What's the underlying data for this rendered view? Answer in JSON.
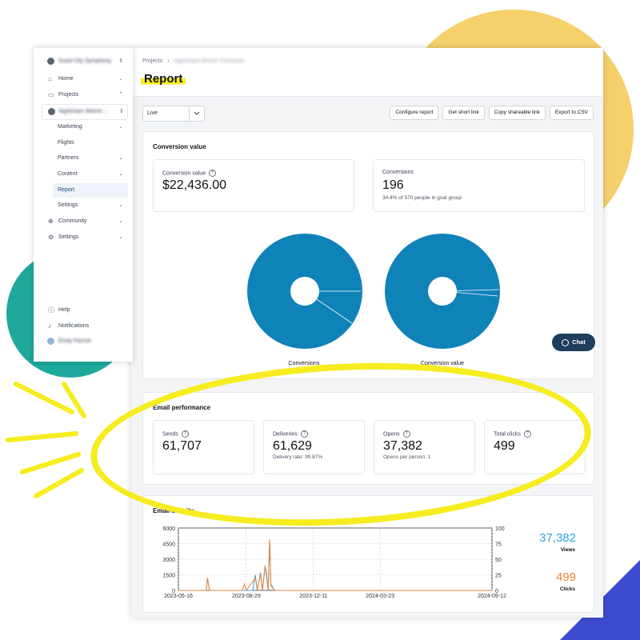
{
  "sidebar": {
    "org_name": "Good City Symphony",
    "items": [
      {
        "label": "Home",
        "icon": "home-icon"
      },
      {
        "label": "Projects",
        "icon": "folder-icon"
      },
      {
        "label": "Nightmare Before ...",
        "icon": "avatar"
      },
      {
        "label": "Marketing"
      },
      {
        "label": "Flights"
      },
      {
        "label": "Partners"
      },
      {
        "label": "Content"
      },
      {
        "label": "Report"
      },
      {
        "label": "Settings"
      },
      {
        "label": "Community",
        "icon": "community-icon"
      },
      {
        "label": "Settings",
        "icon": "gear-icon"
      }
    ],
    "footer": [
      {
        "label": "Help",
        "icon": "help-icon"
      },
      {
        "label": "Notifications",
        "icon": "bell-icon"
      },
      {
        "label": "Emily Parrish",
        "icon": "avatar"
      }
    ]
  },
  "header": {
    "breadcrumb_root": "Projects",
    "breadcrumb_sep": "›",
    "breadcrumb_current": "Nightmare Before Christmas",
    "title": "Report"
  },
  "toolbar": {
    "select_value": "Live",
    "buttons": [
      "Configure report",
      "Get short link",
      "Copy shareable link",
      "Export to CSV"
    ]
  },
  "conversion": {
    "title": "Conversion value",
    "value_label": "Conversion value",
    "value": "$22,436.00",
    "count_label": "Conversions",
    "count": "196",
    "count_sub": "34.4% of 570 people in goal group",
    "pie1_label": "Conversions",
    "pie2_label": "Conversion value"
  },
  "chat_label": "Chat",
  "email_performance": {
    "title": "Email performance",
    "stats": [
      {
        "label": "Sends",
        "value": "61,707",
        "sub": ""
      },
      {
        "label": "Deliveries",
        "value": "61,629",
        "sub": "Delivery rate: 99.87%"
      },
      {
        "label": "Opens",
        "value": "37,382",
        "sub": "Opens per person: 1"
      },
      {
        "label": "Total clicks",
        "value": "499",
        "sub": ""
      }
    ]
  },
  "email_activity": {
    "title": "Email activity",
    "views_value": "37,382",
    "views_label": "Views",
    "clicks_value": "499",
    "clicks_label": "Clicks"
  },
  "colors": {
    "pie": "#0f82b8",
    "views": "#30a6e0",
    "clicks": "#e8843a",
    "highlight": "#f6ec1f"
  },
  "chart_data": {
    "type": "line",
    "x_ticks": [
      "2023-05-16",
      "2023-08-29",
      "2023-12-11",
      "2024-03-23",
      "2024-09-12"
    ],
    "y_left_ticks": [
      "6000",
      "4500",
      "3000",
      "1500",
      "0"
    ],
    "y_right_ticks": [
      "100",
      "75",
      "50",
      "25",
      "0"
    ],
    "ylim_left": [
      0,
      6000
    ],
    "ylim_right": [
      0,
      100
    ],
    "series": [
      {
        "name": "Views",
        "axis": "left",
        "points": [
          [
            "2023-05-16",
            0
          ],
          [
            "2023-06-28",
            0
          ],
          [
            "2023-06-30",
            1200
          ],
          [
            "2023-07-03",
            0
          ],
          [
            "2023-09-08",
            0
          ],
          [
            "2023-09-12",
            1500
          ],
          [
            "2023-09-15",
            0
          ],
          [
            "2023-09-20",
            1700
          ],
          [
            "2023-09-23",
            0
          ],
          [
            "2023-09-27",
            2300
          ],
          [
            "2023-09-29",
            1800
          ],
          [
            "2023-10-02",
            0
          ],
          [
            "2023-10-04",
            4900
          ],
          [
            "2023-10-06",
            600
          ],
          [
            "2023-10-12",
            0
          ],
          [
            "2024-09-12",
            0
          ]
        ]
      },
      {
        "name": "Clicks",
        "axis": "right",
        "points": [
          [
            "2023-05-16",
            0
          ],
          [
            "2023-06-28",
            0
          ],
          [
            "2023-06-30",
            20
          ],
          [
            "2023-07-03",
            0
          ],
          [
            "2023-08-23",
            0
          ],
          [
            "2023-08-26",
            10
          ],
          [
            "2023-08-29",
            0
          ],
          [
            "2023-09-12",
            20
          ],
          [
            "2023-09-15",
            0
          ],
          [
            "2023-09-20",
            26
          ],
          [
            "2023-09-23",
            0
          ],
          [
            "2023-09-27",
            40
          ],
          [
            "2023-10-02",
            0
          ],
          [
            "2023-10-04",
            82
          ],
          [
            "2023-10-06",
            8
          ],
          [
            "2023-10-12",
            0
          ],
          [
            "2024-09-12",
            0
          ]
        ]
      }
    ]
  }
}
